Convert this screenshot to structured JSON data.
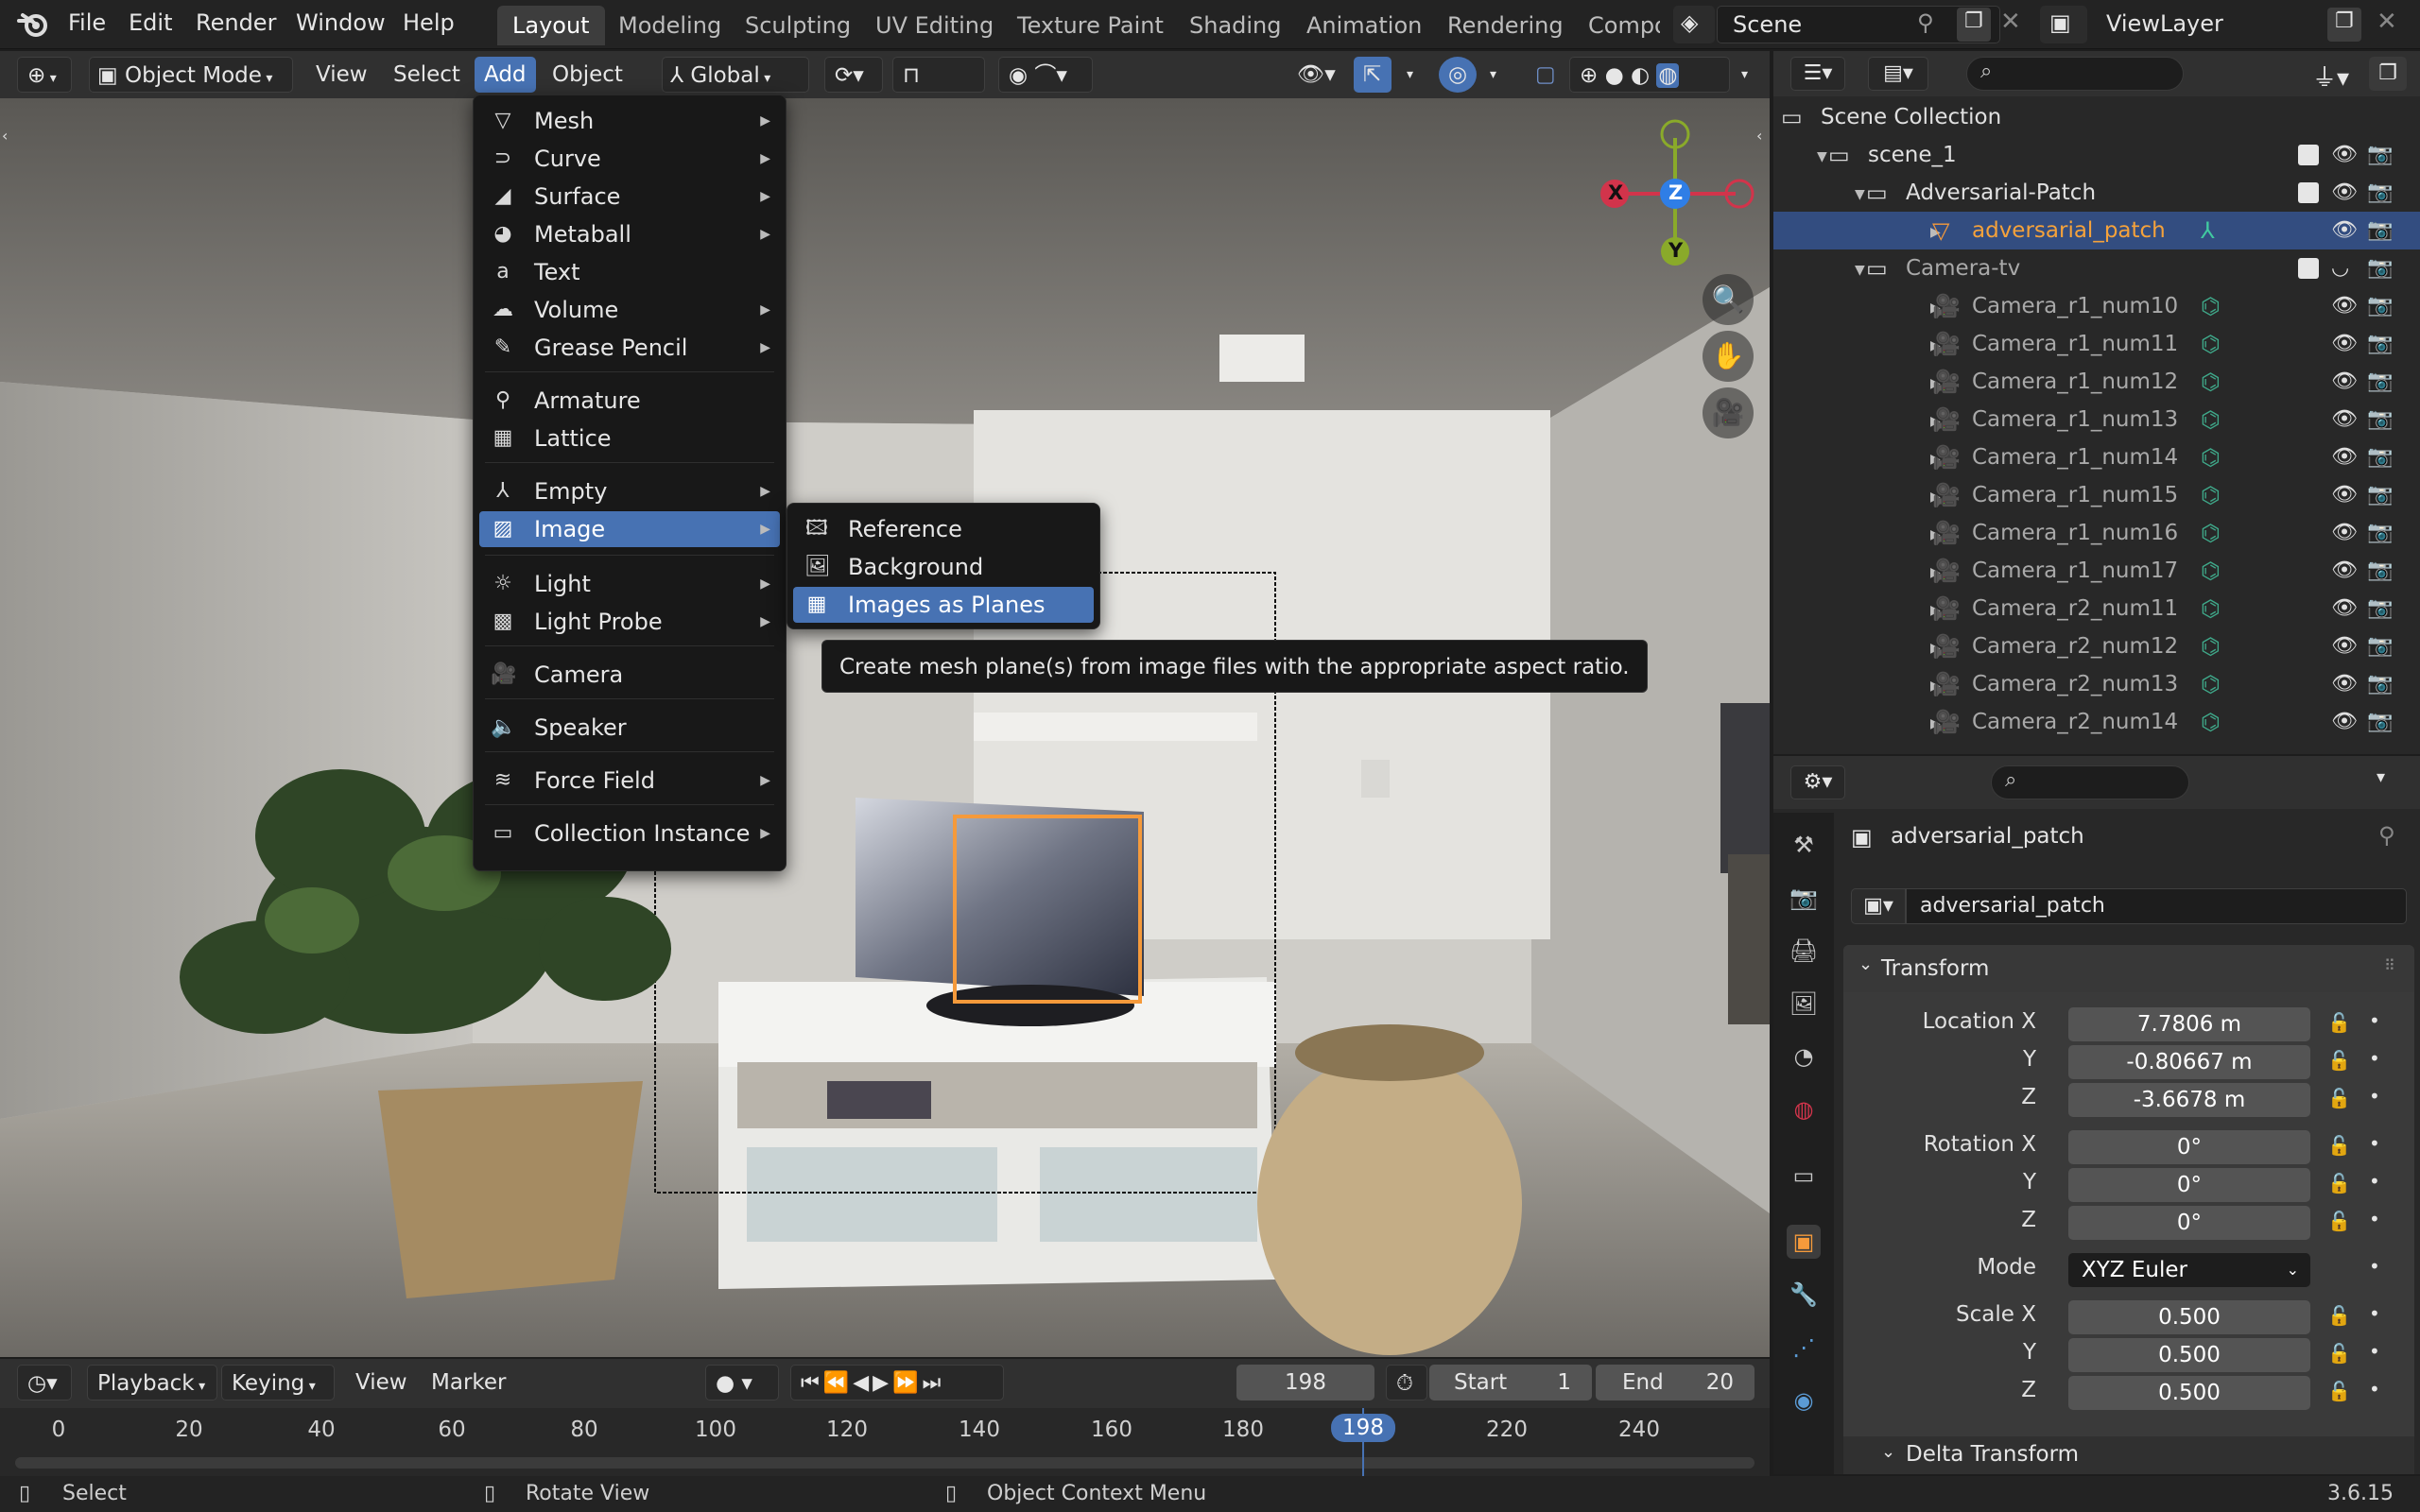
{
  "topbar": {
    "menus": [
      "File",
      "Edit",
      "Render",
      "Window",
      "Help"
    ],
    "workspaces": [
      "Layout",
      "Modeling",
      "Sculpting",
      "UV Editing",
      "Texture Paint",
      "Shading",
      "Animation",
      "Rendering",
      "Compo"
    ],
    "active_workspace": "Layout",
    "scene_label": "Scene",
    "viewlayer_label": "ViewLayer"
  },
  "viewport_header": {
    "mode": "Object Mode",
    "menus": [
      "View",
      "Select",
      "Add",
      "Object"
    ],
    "active_menu": "Add",
    "orientation": "Global"
  },
  "add_menu": {
    "items": [
      {
        "label": "Mesh",
        "icon": "mesh-icon",
        "sub": true
      },
      {
        "label": "Curve",
        "icon": "curve-icon",
        "sub": true
      },
      {
        "label": "Surface",
        "icon": "surface-icon",
        "sub": true
      },
      {
        "label": "Metaball",
        "icon": "metaball-icon",
        "sub": true
      },
      {
        "label": "Text",
        "icon": "text-icon",
        "sub": false
      },
      {
        "label": "Volume",
        "icon": "volume-icon",
        "sub": true
      },
      {
        "label": "Grease Pencil",
        "icon": "grease-pencil-icon",
        "sub": true
      },
      {
        "label": "Armature",
        "icon": "armature-icon",
        "sub": false
      },
      {
        "label": "Lattice",
        "icon": "lattice-icon",
        "sub": false
      },
      {
        "label": "Empty",
        "icon": "empty-icon",
        "sub": true
      },
      {
        "label": "Image",
        "icon": "image-icon",
        "sub": true
      },
      {
        "label": "Light",
        "icon": "light-icon",
        "sub": true
      },
      {
        "label": "Light Probe",
        "icon": "light-probe-icon",
        "sub": true
      },
      {
        "label": "Camera",
        "icon": "camera-icon",
        "sub": false
      },
      {
        "label": "Speaker",
        "icon": "speaker-icon",
        "sub": false
      },
      {
        "label": "Force Field",
        "icon": "force-field-icon",
        "sub": true
      },
      {
        "label": "Collection Instance",
        "icon": "collection-instance-icon",
        "sub": true
      }
    ],
    "selected": "Image"
  },
  "image_submenu": {
    "items": [
      "Reference",
      "Background",
      "Images as Planes"
    ],
    "selected": "Images as Planes",
    "tooltip": "Create mesh plane(s) from image files with the appropriate aspect ratio."
  },
  "gizmo": {
    "x": "X",
    "y": "Y",
    "z": "Z"
  },
  "outliner": {
    "rows": [
      {
        "label": "Scene Collection",
        "level": 0
      },
      {
        "label": "scene_1",
        "level": 1
      },
      {
        "label": "Adversarial-Patch",
        "level": 2
      },
      {
        "label": "adversarial_patch",
        "level": 3,
        "selected": true
      },
      {
        "label": "Camera-tv",
        "level": 2
      },
      {
        "label": "Camera_r1_num10",
        "level": 3
      },
      {
        "label": "Camera_r1_num11",
        "level": 3
      },
      {
        "label": "Camera_r1_num12",
        "level": 3
      },
      {
        "label": "Camera_r1_num13",
        "level": 3
      },
      {
        "label": "Camera_r1_num14",
        "level": 3
      },
      {
        "label": "Camera_r1_num15",
        "level": 3
      },
      {
        "label": "Camera_r1_num16",
        "level": 3
      },
      {
        "label": "Camera_r1_num17",
        "level": 3
      },
      {
        "label": "Camera_r2_num11",
        "level": 3
      },
      {
        "label": "Camera_r2_num12",
        "level": 3
      },
      {
        "label": "Camera_r2_num13",
        "level": 3
      },
      {
        "label": "Camera_r2_num14",
        "level": 3
      }
    ]
  },
  "properties": {
    "object_name": "adversarial_patch",
    "datablock_name": "adversarial_patch",
    "transform_header": "Transform",
    "location_label": "Location X",
    "rotation_label": "Rotation X",
    "scale_label": "Scale X",
    "axis_y": "Y",
    "axis_z": "Z",
    "location": [
      "7.7806 m",
      "-0.80667 m",
      "-3.6678 m"
    ],
    "rotation": [
      "0°",
      "0°",
      "0°"
    ],
    "mode_label": "Mode",
    "mode_value": "XYZ Euler",
    "scale": [
      "0.500",
      "0.500",
      "0.500"
    ],
    "delta_header": "Delta Transform"
  },
  "timeline": {
    "menus": [
      "Playback",
      "Keying",
      "View",
      "Marker"
    ],
    "current_frame": "198",
    "start_label": "Start",
    "start_value": "1",
    "end_label": "End",
    "end_value": "20",
    "ruler": [
      "0",
      "20",
      "40",
      "60",
      "80",
      "100",
      "120",
      "140",
      "160",
      "180",
      "198",
      "220",
      "240"
    ]
  },
  "statusbar": {
    "select": "Select",
    "rotate": "Rotate View",
    "context": "Object Context Menu",
    "version": "3.6.15"
  },
  "colors": {
    "accent": "#4772b3",
    "selection_orange": "#f59a3b",
    "outliner_selected": "#334d80"
  }
}
